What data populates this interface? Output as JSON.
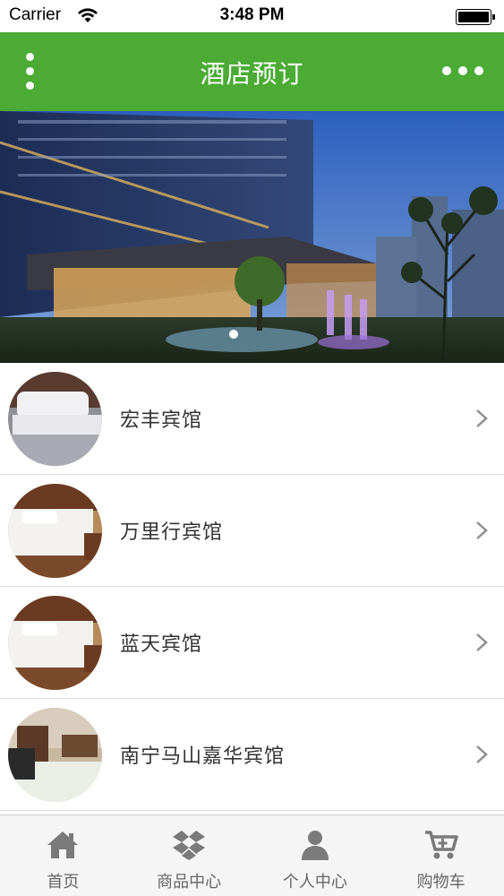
{
  "status_bar": {
    "carrier": "Carrier",
    "time": "3:48 PM"
  },
  "header": {
    "title": "酒店预订",
    "left_icon": "vertical-dots-menu-icon",
    "right_icon": "horizontal-dots-more-icon",
    "color": "#4bab35"
  },
  "banner": {
    "slide_count": 1,
    "active_slide": 1
  },
  "hotels": [
    {
      "name": "宏丰宾馆",
      "thumb": "bed-thumbnail"
    },
    {
      "name": "万里行宾馆",
      "thumb": "bed-thumbnail"
    },
    {
      "name": "蓝天宾馆",
      "thumb": "bed-thumbnail"
    },
    {
      "name": "南宁马山嘉华宾馆",
      "thumb": "room-thumbnail"
    }
  ],
  "tabs": [
    {
      "label": "首页",
      "icon": "home-icon"
    },
    {
      "label": "商品中心",
      "icon": "dropbox-icon"
    },
    {
      "label": "个人中心",
      "icon": "user-icon"
    },
    {
      "label": "购物车",
      "icon": "cart-icon"
    }
  ]
}
